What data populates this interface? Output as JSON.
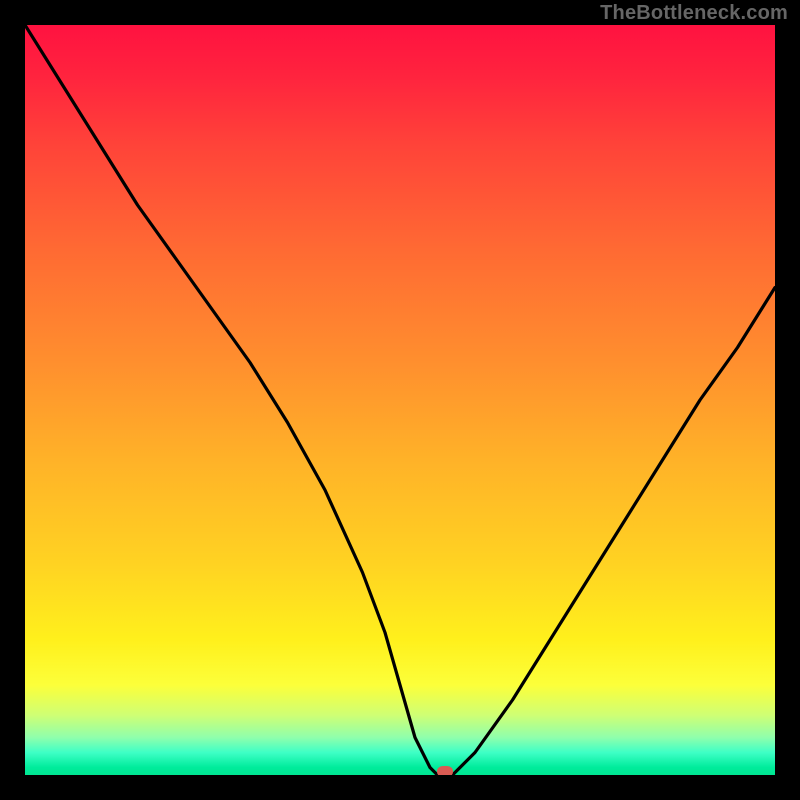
{
  "watermark": "TheBottleneck.com",
  "colors": {
    "frame": "#000000",
    "watermark_text": "#666666",
    "curve": "#000000",
    "marker": "#d95b53",
    "gradient_stops": [
      "#ff1240",
      "#ff243e",
      "#ff4339",
      "#ff6a33",
      "#ff8f2e",
      "#ffb228",
      "#ffd322",
      "#fff01c",
      "#fcff3a",
      "#cfff74",
      "#8fffac",
      "#3effc6",
      "#00ec9b",
      "#00e692"
    ]
  },
  "chart_data": {
    "type": "line",
    "title": "",
    "xlabel": "",
    "ylabel": "",
    "xlim": [
      0,
      100
    ],
    "ylim": [
      0,
      100
    ],
    "background": "vertical red→yellow→green gradient (y≈0 green, y≈100 red)",
    "series": [
      {
        "name": "bottleneck-curve",
        "x": [
          0,
          5,
          10,
          15,
          20,
          25,
          30,
          35,
          40,
          45,
          48,
          50,
          52,
          54,
          55,
          57,
          60,
          65,
          70,
          75,
          80,
          85,
          90,
          95,
          100
        ],
        "y": [
          100,
          92,
          84,
          76,
          69,
          62,
          55,
          47,
          38,
          27,
          19,
          12,
          5,
          1,
          0,
          0,
          3,
          10,
          18,
          26,
          34,
          42,
          50,
          57,
          65
        ]
      }
    ],
    "annotations": [
      {
        "name": "optimal-marker",
        "shape": "rounded-rect",
        "x": 56,
        "y": 0.6,
        "color": "#d95b53"
      }
    ],
    "notes": "No axis ticks or numeric labels are visible; values are estimated from pixel positions on a 0–100 normalized scale."
  }
}
